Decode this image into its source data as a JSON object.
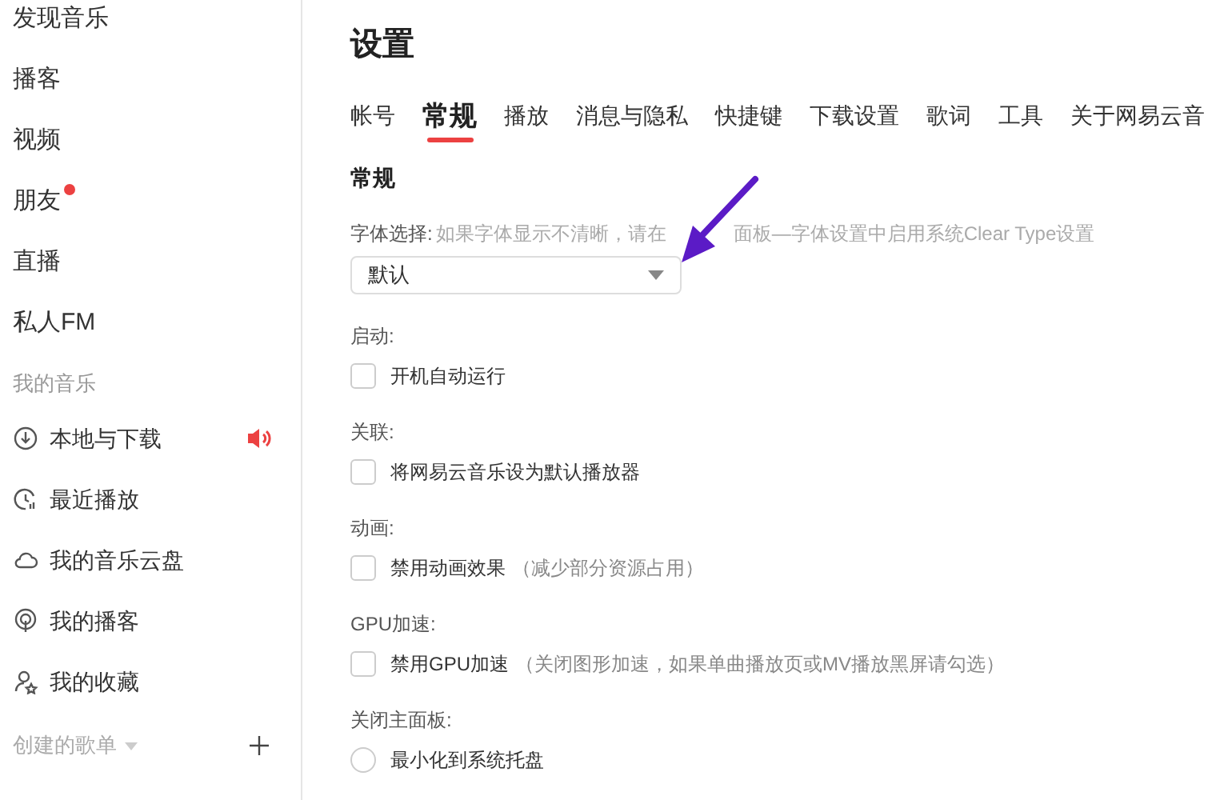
{
  "sidebar": {
    "items": [
      {
        "label": "发现音乐",
        "selected": false
      },
      {
        "label": "播客",
        "selected": false
      },
      {
        "label": "视频",
        "selected": false
      },
      {
        "label": "朋友",
        "selected": false,
        "badge_dot": true
      },
      {
        "label": "直播",
        "selected": false
      },
      {
        "label": "私人FM",
        "selected": false
      }
    ],
    "my_music": {
      "title": "我的音乐",
      "items": [
        {
          "label": "本地与下载",
          "playing": true
        },
        {
          "label": "最近播放",
          "playing": false
        },
        {
          "label": "我的音乐云盘",
          "playing": false
        },
        {
          "label": "我的播客",
          "playing": false
        },
        {
          "label": "我的收藏",
          "playing": false
        }
      ]
    },
    "playlists": {
      "title": "创建的歌单"
    }
  },
  "settings": {
    "title": "设置",
    "tabs": [
      {
        "label": "帐号",
        "selected": false
      },
      {
        "label": "常规",
        "selected": true
      },
      {
        "label": "播放",
        "selected": false
      },
      {
        "label": "消息与隐私",
        "selected": false
      },
      {
        "label": "快捷键",
        "selected": false
      },
      {
        "label": "下载设置",
        "selected": false
      },
      {
        "label": "歌词",
        "selected": false
      },
      {
        "label": "工具",
        "selected": false
      },
      {
        "label": "关于网易云音",
        "selected": false
      }
    ],
    "section_title": "常规",
    "font": {
      "label": "字体选择:",
      "hint_parts": [
        "如果字体显示不清晰，请在",
        "面板—字体设置中启用系统Clear Type设置"
      ],
      "value": "默认"
    },
    "groups": [
      {
        "label": "启动:",
        "options": [
          {
            "kind": "checkbox",
            "label": "开机自动运行",
            "checked": false
          }
        ]
      },
      {
        "label": "关联:",
        "options": [
          {
            "kind": "checkbox",
            "label": "将网易云音乐设为默认播放器",
            "checked": false
          }
        ]
      },
      {
        "label": "动画:",
        "options": [
          {
            "kind": "checkbox",
            "label": "禁用动画效果",
            "note": "（减少部分资源占用）",
            "checked": false
          }
        ]
      },
      {
        "label": "GPU加速:",
        "options": [
          {
            "kind": "checkbox",
            "label": "禁用GPU加速",
            "note": "（关闭图形加速，如果单曲播放页或MV播放黑屏请勾选）",
            "checked": false
          }
        ]
      },
      {
        "label": "关闭主面板:",
        "options": [
          {
            "kind": "radio",
            "label": "最小化到系统托盘",
            "checked": false
          }
        ]
      }
    ]
  }
}
